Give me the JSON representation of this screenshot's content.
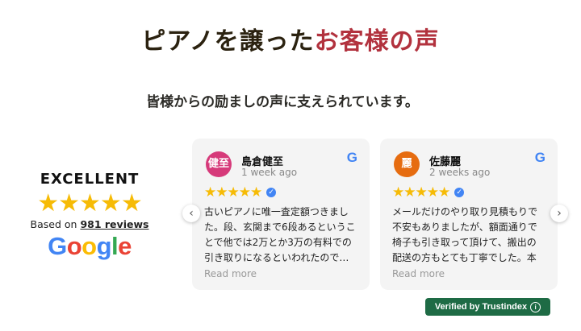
{
  "title": {
    "part1": "ピアノを譲った",
    "part2": "お客様の声"
  },
  "subtitle": "皆様からの励ましの声に支えられています。",
  "summary": {
    "rating_word": "EXCELLENT",
    "stars": "★★★★★",
    "based_on": "Based on",
    "review_count": "981 reviews",
    "logo_letters": [
      "G",
      "o",
      "o",
      "g",
      "l",
      "e"
    ]
  },
  "reviews": [
    {
      "avatar_text": "健至",
      "avatar_color": "#d63a7a",
      "name": "島倉健至",
      "time": "1 week ago",
      "stars": "★★★★★",
      "text": "古いピアノに唯一査定額つきました。段、玄関まで6段あるということで他では2万とか3万の有料での引き取りになるといわれたので…",
      "read_more": "Read more"
    },
    {
      "avatar_text": "麗",
      "avatar_color": "#e66c10",
      "name": "佐藤麗",
      "time": "2 weeks ago",
      "stars": "★★★★★",
      "text": "メールだけのやり取り見積もりで不安もありましたが、額面通りで椅子も引き取って頂けて、搬出の配送の方もとても丁寧でした。本当に…",
      "read_more": "Read more"
    }
  ],
  "nav": {
    "prev": "‹",
    "next": "›"
  },
  "badge": {
    "label": "Verified by Trustindex",
    "info": "i"
  },
  "colors": {
    "star": "#f6bb06",
    "accent_red": "#b2323e",
    "badge_green": "#1e6b45"
  }
}
